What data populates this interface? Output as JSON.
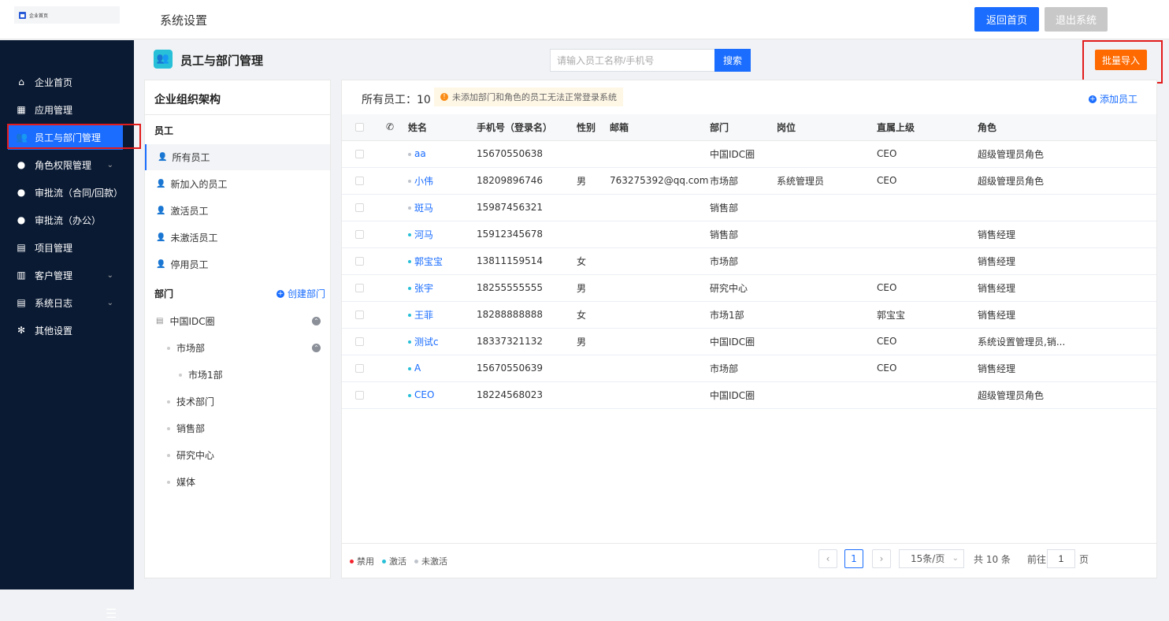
{
  "header": {
    "logo_text": "企业首页",
    "title": "系统设置",
    "home_label": "返回首页",
    "logout_label": "退出系统"
  },
  "sidebar": {
    "items": [
      {
        "label": "企业首页",
        "icon": "home-icon"
      },
      {
        "label": "应用管理",
        "icon": "grid-icon"
      },
      {
        "label": "员工与部门管理",
        "icon": "users-icon"
      },
      {
        "label": "角色权限管理",
        "icon": "user-icon"
      },
      {
        "label": "审批流（合同/回款）",
        "icon": "user-icon"
      },
      {
        "label": "审批流（办公）",
        "icon": "user-icon"
      },
      {
        "label": "项目管理",
        "icon": "project-icon"
      },
      {
        "label": "客户管理",
        "icon": "building-icon"
      },
      {
        "label": "系统日志",
        "icon": "log-icon"
      },
      {
        "label": "其他设置",
        "icon": "gear-icon"
      }
    ],
    "active_index": 2
  },
  "page": {
    "title": "员工与部门管理",
    "search_placeholder": "请输入员工名称/手机号",
    "search_label": "搜索",
    "import_label": "批量导入"
  },
  "org": {
    "title": "企业组织架构",
    "employees_heading": "员工",
    "employee_filters": [
      "所有员工",
      "新加入的员工",
      "激活员工",
      "未激活员工",
      "停用员工"
    ],
    "dept_heading": "部门",
    "create_dept_label": "创建部门",
    "root_dept": "中国IDC圈",
    "depts": [
      {
        "name": "市场部",
        "level": 1
      },
      {
        "name": "市场1部",
        "level": 2
      },
      {
        "name": "技术部门",
        "level": 1
      },
      {
        "name": "销售部",
        "level": 1
      },
      {
        "name": "研究中心",
        "level": 1
      },
      {
        "name": "媒体",
        "level": 1
      }
    ]
  },
  "employees": {
    "count_label": "所有员工：10",
    "notice": "未添加部门和角色的员工无法正常登录系统",
    "add_label": "添加员工",
    "columns": [
      "姓名",
      "手机号（登录名）",
      "性别",
      "邮箱",
      "部门",
      "岗位",
      "直属上级",
      "角色"
    ],
    "rows": [
      {
        "name": "aa",
        "status": "inactive",
        "phone": "15670550638",
        "gender": "",
        "email": "",
        "dept": "中国IDC圈",
        "post": "",
        "manager": "CEO",
        "role": "超级管理员角色"
      },
      {
        "name": "小伟",
        "status": "inactive",
        "phone": "18209896746",
        "gender": "男",
        "email": "763275392@qq.com",
        "dept": "市场部",
        "post": "系统管理员",
        "manager": "CEO",
        "role": "超级管理员角色"
      },
      {
        "name": "斑马",
        "status": "inactive",
        "phone": "15987456321",
        "gender": "",
        "email": "",
        "dept": "销售部",
        "post": "",
        "manager": "",
        "role": ""
      },
      {
        "name": "河马",
        "status": "active",
        "phone": "15912345678",
        "gender": "",
        "email": "",
        "dept": "销售部",
        "post": "",
        "manager": "",
        "role": "销售经理"
      },
      {
        "name": "郭宝宝",
        "status": "active",
        "phone": "13811159514",
        "gender": "女",
        "email": "",
        "dept": "市场部",
        "post": "",
        "manager": "",
        "role": "销售经理"
      },
      {
        "name": "张宇",
        "status": "active",
        "phone": "18255555555",
        "gender": "男",
        "email": "",
        "dept": "研究中心",
        "post": "",
        "manager": "CEO",
        "role": "销售经理"
      },
      {
        "name": "王菲",
        "status": "active",
        "phone": "18288888888",
        "gender": "女",
        "email": "",
        "dept": "市场1部",
        "post": "",
        "manager": "郭宝宝",
        "role": "销售经理"
      },
      {
        "name": "测试c",
        "status": "active",
        "phone": "18337321132",
        "gender": "男",
        "email": "",
        "dept": "中国IDC圈",
        "post": "",
        "manager": "CEO",
        "role": "系统设置管理员,销..."
      },
      {
        "name": "A",
        "status": "active",
        "phone": "15670550639",
        "gender": "",
        "email": "",
        "dept": "市场部",
        "post": "",
        "manager": "CEO",
        "role": "销售经理"
      },
      {
        "name": "CEO",
        "status": "active",
        "phone": "18224568023",
        "gender": "",
        "email": "",
        "dept": "中国IDC圈",
        "post": "",
        "manager": "",
        "role": "超级管理员角色"
      }
    ]
  },
  "legend": {
    "disabled": "禁用",
    "active": "激活",
    "inactive": "未激活"
  },
  "pagination": {
    "current_page": "1",
    "page_size": "15条/页",
    "total": "共 10 条",
    "goto_label": "前往",
    "goto_value": "1",
    "page_suffix": "页"
  },
  "colors": {
    "primary": "#1a6dff",
    "sidebar_bg": "#0a1a33",
    "import_btn": "#ff6a00",
    "highlight_border": "#e21b1b",
    "status_active": "#27c0d8",
    "status_inactive": "#bfc4cc",
    "status_disabled": "#f5222d"
  }
}
